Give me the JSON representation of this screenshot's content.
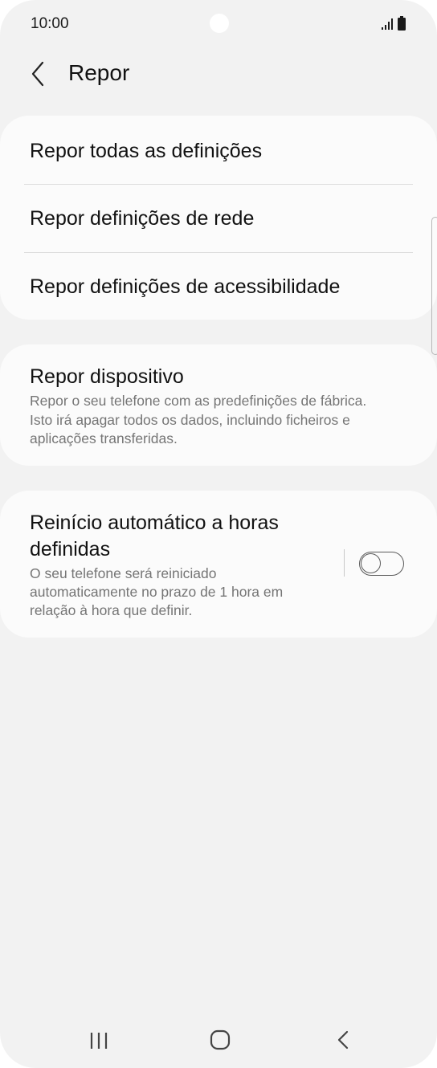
{
  "status_bar": {
    "time": "10:00",
    "icons": [
      "signal-icon",
      "battery-icon"
    ]
  },
  "header": {
    "title": "Repor",
    "back_icon": "chevron-left-icon"
  },
  "reset_options": [
    {
      "label": "Repor todas as definições"
    },
    {
      "label": "Repor definições de rede"
    },
    {
      "label": "Repor definições de acessibilidade"
    }
  ],
  "device_reset": {
    "title": "Repor dispositivo",
    "description_lines": [
      "Repor o seu telefone com as predefinições de fábrica.",
      "Isto irá apagar todos os dados, incluindo ficheiros e",
      "aplicações transferidas."
    ]
  },
  "auto_restart": {
    "title_lines": [
      "Reinício automático a horas",
      "definidas"
    ],
    "description_lines": [
      "O seu telefone será reiniciado",
      "automaticamente no prazo de 1 hora em",
      "relação à hora que definir."
    ],
    "toggle_on": false
  },
  "nav_bar": {
    "icons": [
      "recent-apps-icon",
      "home-icon",
      "back-icon"
    ]
  },
  "colors": {
    "background": "#f2f2f2",
    "card": "#fbfbfb",
    "text_primary": "#111111",
    "text_secondary": "#757575"
  }
}
